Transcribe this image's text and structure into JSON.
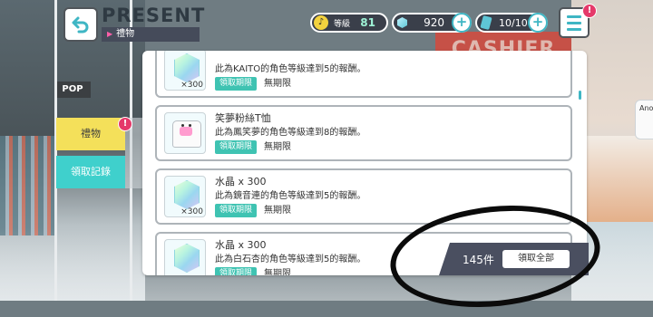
{
  "header": {
    "title": "PRESENT",
    "subtitle": "禮物"
  },
  "resources": {
    "rank_label": "等級",
    "rank_value": "81",
    "crystal_value": "920",
    "ticket_value": "10/10"
  },
  "badges": {
    "menu": "!",
    "gift_tab": "!"
  },
  "tabs": [
    {
      "label": "禮物"
    },
    {
      "label": "領取記錄"
    }
  ],
  "background": {
    "shop_sign": "POP",
    "cashier_sign": "CASHIER",
    "side_card": "Ano"
  },
  "gifts": [
    {
      "title": "",
      "desc": "此為KAITO的角色等級達到5的報酬。",
      "qty": "×300",
      "icon": "crystal-icon",
      "claim_label": "領取期限",
      "limit": "無期限"
    },
    {
      "title": "笑夢粉絲T恤",
      "desc": "此為鳳笑夢的角色等級達到8的報酬。",
      "qty": "",
      "icon": "tshirt-icon",
      "claim_label": "領取期限",
      "limit": "無期限"
    },
    {
      "title": "水晶 x 300",
      "desc": "此為鏡音連的角色等級達到5的報酬。",
      "qty": "×300",
      "icon": "crystal-icon",
      "claim_label": "領取期限",
      "limit": "無期限"
    },
    {
      "title": "水晶 x 300",
      "desc": "此為白石杏的角色等級達到5的報酬。",
      "qty": "",
      "icon": "crystal-icon",
      "claim_label": "領取期限",
      "limit": "無期限"
    }
  ],
  "footer": {
    "count": "145件",
    "claim_all": "領取全部"
  },
  "colors": {
    "accent": "#3fb6c4",
    "chip": "#3fc3b2",
    "gift_tab": "#f4e05a",
    "history_tab": "#3fd0cc",
    "badge": "#e5396a"
  }
}
